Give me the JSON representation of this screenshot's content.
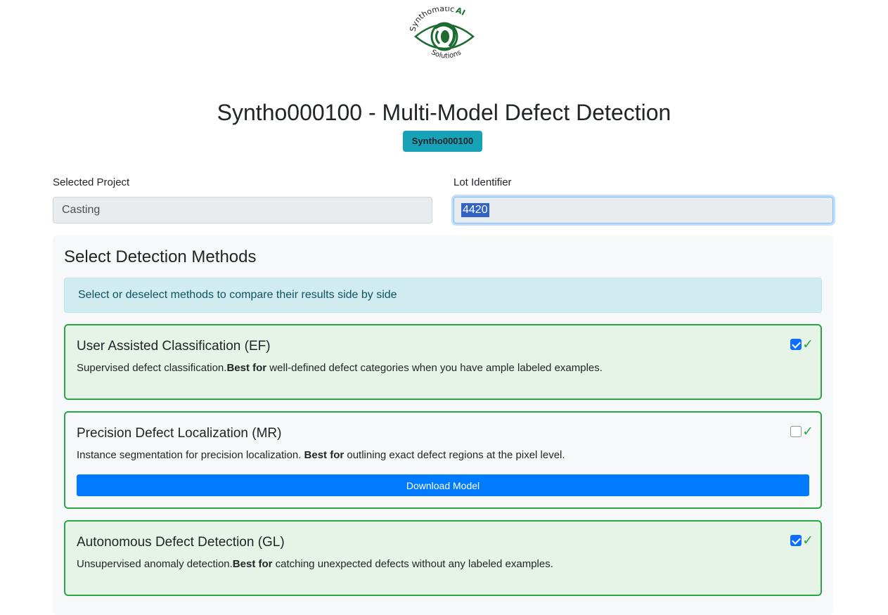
{
  "logo": {
    "top_text": "Synthomatic",
    "accent_text": "AI",
    "bottom_text": "Solutions",
    "icon": "eye-logo-icon",
    "color": "#1e6b32"
  },
  "header": {
    "title": "Syntho000100 - Multi-Model Defect Detection",
    "badge": "Syntho000100"
  },
  "form": {
    "project_label": "Selected Project",
    "project_value": "Casting",
    "lot_label": "Lot Identifier",
    "lot_value": "4420"
  },
  "methods_panel": {
    "title": "Select Detection Methods",
    "info": "Select or deselect methods to compare their results side by side",
    "methods": [
      {
        "title": "User Assisted Classification (EF)",
        "desc_before": "Supervised defect classification.",
        "desc_bold": "Best for",
        "desc_after": " well-defined defect categories when you have ample labeled examples.",
        "checked": true,
        "tick": "✓"
      },
      {
        "title": "Precision Defect Localization (MR)",
        "desc_before": "Instance segmentation for precision localization. ",
        "desc_bold": "Best for",
        "desc_after": " outlining exact defect regions at the pixel level.",
        "checked": false,
        "tick": "✓",
        "button_label": "Download Model"
      },
      {
        "title": "Autonomous Defect Detection (GL)",
        "desc_before": "Unsupervised anomaly detection.",
        "desc_bold": "Best for",
        "desc_after": " catching unexpected defects without any labeled examples.",
        "checked": true,
        "tick": "✓"
      }
    ]
  },
  "colors": {
    "accent_green": "#28a745",
    "badge_teal": "#17a2b8",
    "primary_blue": "#007bff",
    "info_bg": "#d1ecf1"
  }
}
